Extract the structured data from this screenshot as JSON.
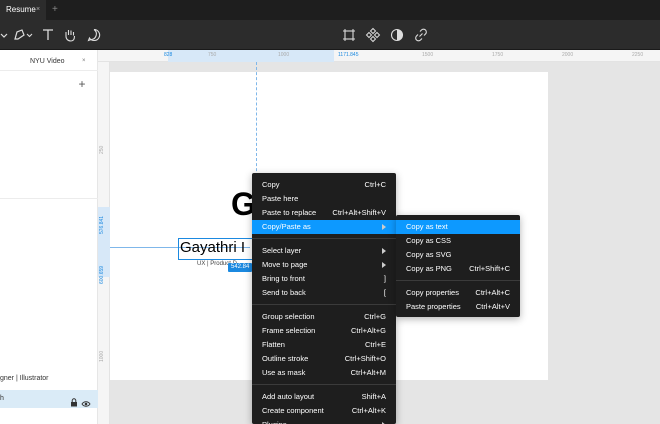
{
  "tab": {
    "title": "Resume",
    "close": "×",
    "add": "+"
  },
  "left_panel": {
    "file_name": "NYU Video",
    "layer_text": "gner | Illustrator",
    "selected_layer": "h"
  },
  "ruler": {
    "top_labels": [
      "828",
      "750",
      "1000",
      "1171.845",
      "1500",
      "1750",
      "2000",
      "2250"
    ],
    "left_labels": [
      "250",
      "576.841",
      "600.659",
      "1000"
    ]
  },
  "canvas": {
    "big_letter": "G",
    "name_text": "Gayathri I",
    "dimension_badge": "542.84",
    "subtitle": "UX | Product D"
  },
  "context_menu": {
    "groups": [
      [
        {
          "label": "Copy",
          "shortcut": "Ctrl+C"
        },
        {
          "label": "Paste here",
          "shortcut": ""
        },
        {
          "label": "Paste to replace",
          "shortcut": "Ctrl+Alt+Shift+V"
        },
        {
          "label": "Copy/Paste as",
          "shortcut": "",
          "submenu": true,
          "active": true
        }
      ],
      [
        {
          "label": "Select layer",
          "shortcut": "",
          "submenu": true
        },
        {
          "label": "Move to page",
          "shortcut": "",
          "submenu": true
        },
        {
          "label": "Bring to front",
          "shortcut": "]"
        },
        {
          "label": "Send to back",
          "shortcut": "["
        }
      ],
      [
        {
          "label": "Group selection",
          "shortcut": "Ctrl+G"
        },
        {
          "label": "Frame selection",
          "shortcut": "Ctrl+Alt+G"
        },
        {
          "label": "Flatten",
          "shortcut": "Ctrl+E"
        },
        {
          "label": "Outline stroke",
          "shortcut": "Ctrl+Shift+O"
        },
        {
          "label": "Use as mask",
          "shortcut": "Ctrl+Alt+M"
        }
      ],
      [
        {
          "label": "Add auto layout",
          "shortcut": "Shift+A"
        },
        {
          "label": "Create component",
          "shortcut": "Ctrl+Alt+K"
        },
        {
          "label": "Plugins",
          "shortcut": "",
          "submenu": true
        }
      ]
    ]
  },
  "submenu": {
    "groups": [
      [
        {
          "label": "Copy as text",
          "shortcut": "",
          "active": true
        },
        {
          "label": "Copy as CSS",
          "shortcut": ""
        },
        {
          "label": "Copy as SVG",
          "shortcut": ""
        },
        {
          "label": "Copy as PNG",
          "shortcut": "Ctrl+Shift+C"
        }
      ],
      [
        {
          "label": "Copy properties",
          "shortcut": "Ctrl+Alt+C"
        },
        {
          "label": "Paste properties",
          "shortcut": "Ctrl+Alt+V"
        }
      ]
    ]
  },
  "colors": {
    "accent": "#0d99ff",
    "menu_bg": "#1e1e1e",
    "toolbar_bg": "#2c2c2c"
  }
}
